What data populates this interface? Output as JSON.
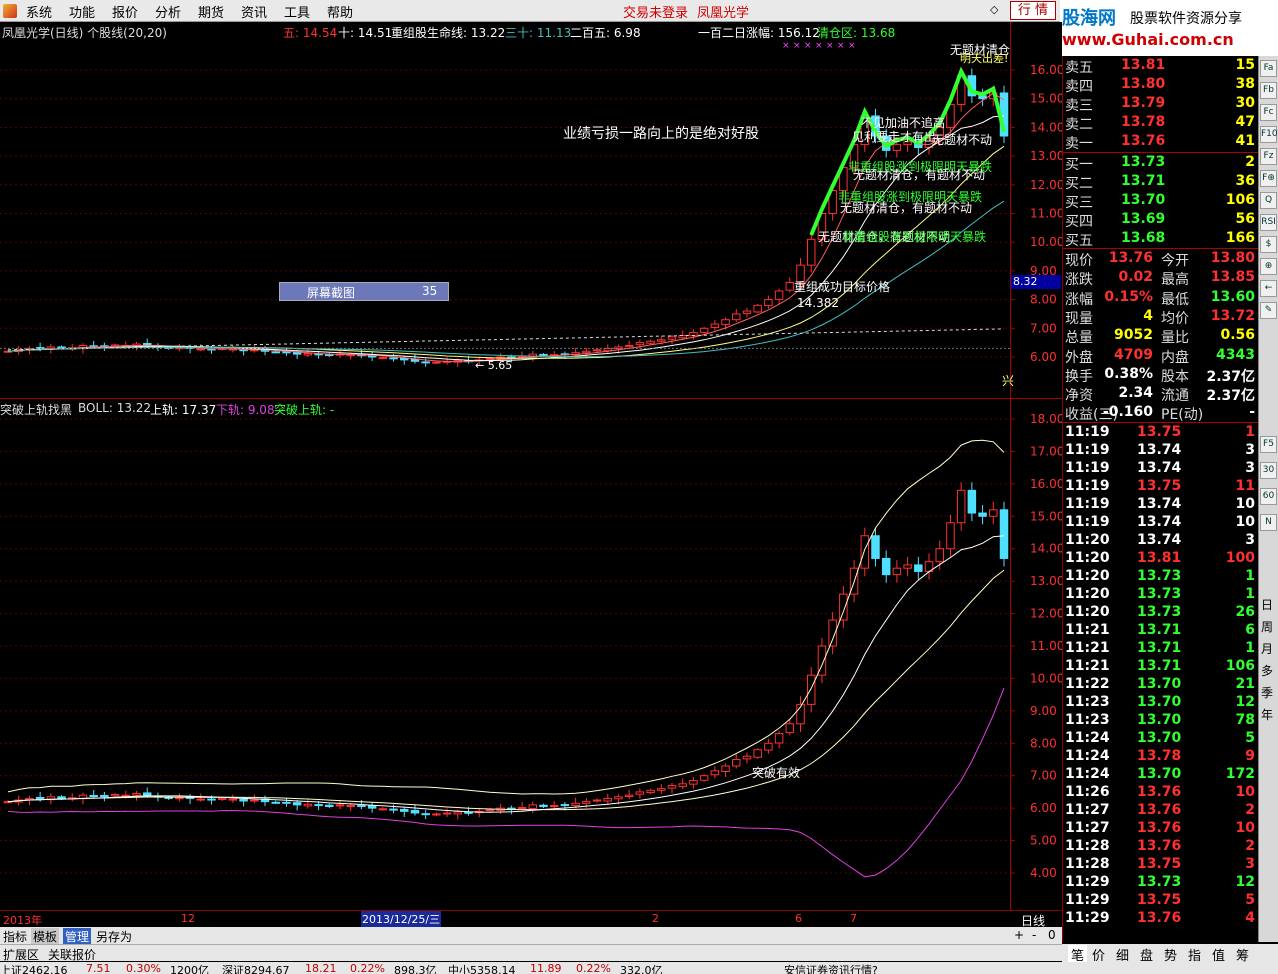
{
  "menu": {
    "items": [
      "系统",
      "功能",
      "报价",
      "分析",
      "期货",
      "资讯",
      "工具",
      "帮助"
    ],
    "login_status": "交易未登录",
    "stock_name": "凤凰光学",
    "quote_button": "行 情"
  },
  "banner": {
    "site_name": "股海网",
    "slogan": "股票软件资源分享",
    "url": "www.Guhai.com.cn"
  },
  "main_chart": {
    "title": "凤凰光学(日线) 个股线(20,20)",
    "ma5": "五: 14.54",
    "ma10": "十: 14.51",
    "restructure_line": "重组股生命线: 13.22",
    "ma30": "三十: 11.13",
    "ma250": "二百五: 6.98",
    "rise_120": "一百二日涨幅: 156.12",
    "clear_zone": "清仓区: 13.68",
    "overlay_text": "业绩亏损一路向上的是绝对好股",
    "target_label": "重组成功目标价格",
    "target_value": "14.382",
    "low_label": "← 5.65",
    "current_price_tag": "8.32",
    "screenshot_label": "屏幕截图",
    "screenshot_count": "35",
    "annotations": {
      "chase": "不见加油不追高",
      "sell": "见利要走才有出",
      "no_theme_1": "无题材不动",
      "warn_1": "非重组股涨到极限明天暴跌",
      "no_theme_2": "无题材清仓，有题材不动",
      "warn_2": "非重组股涨到极限明天暴跌",
      "no_theme_3": "无题材清仓，有题材不动",
      "no_theme_4": "无题材清仓，有题材不动",
      "warn_3": "非重组股涨到极限明天暴跌",
      "top_1": "无题材清仓",
      "top_2": "明天出差!"
    },
    "y_ticks": [
      "16.00",
      "15.00",
      "14.00",
      "13.00",
      "12.00",
      "11.00",
      "10.00",
      "9.00",
      "8.00",
      "7.00",
      "6.00"
    ],
    "x_edge_label": "兴"
  },
  "sub_chart": {
    "title": "突破上轨找黑",
    "boll_label": "BOLL: 13.22",
    "upper_label": "上轨: 17.37",
    "lower_label": "下轨: 9.08",
    "breakout_label": "突破上轨: -",
    "breakout_annotation": "突破有效",
    "y_ticks": [
      "18.00",
      "17.00",
      "16.00",
      "15.00",
      "14.00",
      "13.00",
      "12.00",
      "11.00",
      "10.00",
      "9.00",
      "8.00",
      "7.00",
      "6.00",
      "5.00",
      "4.00"
    ]
  },
  "time_axis": {
    "labels": [
      "2013年",
      "12",
      "2013/12/25/三",
      "2",
      "6",
      "7"
    ],
    "period": "日线"
  },
  "order_book": {
    "asks": [
      {
        "label": "卖五",
        "price": "13.81",
        "vol": "15"
      },
      {
        "label": "卖四",
        "price": "13.80",
        "vol": "38"
      },
      {
        "label": "卖三",
        "price": "13.79",
        "vol": "30"
      },
      {
        "label": "卖二",
        "price": "13.78",
        "vol": "47"
      },
      {
        "label": "卖一",
        "price": "13.76",
        "vol": "41"
      }
    ],
    "bids": [
      {
        "label": "买一",
        "price": "13.73",
        "vol": "2"
      },
      {
        "label": "买二",
        "price": "13.71",
        "vol": "36"
      },
      {
        "label": "买三",
        "price": "13.70",
        "vol": "106"
      },
      {
        "label": "买四",
        "price": "13.69",
        "vol": "56"
      },
      {
        "label": "买五",
        "price": "13.68",
        "vol": "166"
      }
    ]
  },
  "stats": [
    {
      "l1": "现价",
      "v1": "13.76",
      "c1": "#ff3030",
      "l2": "今开",
      "v2": "13.80",
      "c2": "#ff3030"
    },
    {
      "l1": "涨跌",
      "v1": "0.02",
      "c1": "#ff3030",
      "l2": "最高",
      "v2": "13.85",
      "c2": "#ff3030"
    },
    {
      "l1": "涨幅",
      "v1": "0.15%",
      "c1": "#ff3030",
      "l2": "最低",
      "v2": "13.60",
      "c2": "#30ff30"
    },
    {
      "l1": "现量",
      "v1": "4",
      "c1": "#ffff00",
      "l2": "均价",
      "v2": "13.72",
      "c2": "#ff3030"
    },
    {
      "l1": "总量",
      "v1": "9052",
      "c1": "#ffff00",
      "l2": "量比",
      "v2": "0.56",
      "c2": "#ffff00"
    },
    {
      "l1": "外盘",
      "v1": "4709",
      "c1": "#ff3030",
      "l2": "内盘",
      "v2": "4343",
      "c2": "#30ff30"
    },
    {
      "l1": "换手",
      "v1": "0.38%",
      "c1": "#fff",
      "l2": "股本",
      "v2": "2.37亿",
      "c2": "#fff"
    },
    {
      "l1": "净资",
      "v1": "2.34",
      "c1": "#fff",
      "l2": "流通",
      "v2": "2.37亿",
      "c2": "#fff"
    },
    {
      "l1": "收益(三)",
      "v1": "-0.160",
      "c1": "#fff",
      "l2": "PE(动)",
      "v2": "-",
      "c2": "#fff"
    }
  ],
  "ticks": [
    {
      "t": "11:19",
      "p": "13.75",
      "v": "1",
      "c": "#ff3030"
    },
    {
      "t": "11:19",
      "p": "13.74",
      "v": "3",
      "c": "#fff"
    },
    {
      "t": "11:19",
      "p": "13.74",
      "v": "3",
      "c": "#fff"
    },
    {
      "t": "11:19",
      "p": "13.75",
      "v": "11",
      "c": "#ff3030"
    },
    {
      "t": "11:19",
      "p": "13.74",
      "v": "10",
      "c": "#fff"
    },
    {
      "t": "11:19",
      "p": "13.74",
      "v": "10",
      "c": "#fff"
    },
    {
      "t": "11:20",
      "p": "13.74",
      "v": "3",
      "c": "#fff"
    },
    {
      "t": "11:20",
      "p": "13.81",
      "v": "100",
      "c": "#ff3030"
    },
    {
      "t": "11:20",
      "p": "13.73",
      "v": "1",
      "c": "#30ff30"
    },
    {
      "t": "11:20",
      "p": "13.73",
      "v": "1",
      "c": "#30ff30"
    },
    {
      "t": "11:20",
      "p": "13.73",
      "v": "26",
      "c": "#30ff30"
    },
    {
      "t": "11:21",
      "p": "13.71",
      "v": "6",
      "c": "#30ff30"
    },
    {
      "t": "11:21",
      "p": "13.71",
      "v": "1",
      "c": "#30ff30"
    },
    {
      "t": "11:21",
      "p": "13.71",
      "v": "106",
      "c": "#30ff30"
    },
    {
      "t": "11:22",
      "p": "13.70",
      "v": "21",
      "c": "#30ff30"
    },
    {
      "t": "11:23",
      "p": "13.70",
      "v": "12",
      "c": "#30ff30"
    },
    {
      "t": "11:23",
      "p": "13.70",
      "v": "78",
      "c": "#30ff30"
    },
    {
      "t": "11:24",
      "p": "13.70",
      "v": "5",
      "c": "#30ff30"
    },
    {
      "t": "11:24",
      "p": "13.78",
      "v": "9",
      "c": "#ff3030"
    },
    {
      "t": "11:24",
      "p": "13.70",
      "v": "172",
      "c": "#30ff30"
    },
    {
      "t": "11:26",
      "p": "13.76",
      "v": "10",
      "c": "#ff3030"
    },
    {
      "t": "11:27",
      "p": "13.76",
      "v": "2",
      "c": "#ff3030"
    },
    {
      "t": "11:27",
      "p": "13.76",
      "v": "10",
      "c": "#ff3030"
    },
    {
      "t": "11:28",
      "p": "13.76",
      "v": "2",
      "c": "#ff3030"
    },
    {
      "t": "11:28",
      "p": "13.75",
      "v": "3",
      "c": "#ff3030"
    },
    {
      "t": "11:29",
      "p": "13.73",
      "v": "12",
      "c": "#30ff30"
    },
    {
      "t": "11:29",
      "p": "13.75",
      "v": "5",
      "c": "#ff3030"
    },
    {
      "t": "11:29",
      "p": "13.76",
      "v": "4",
      "c": "#ff3030"
    }
  ],
  "tools": [
    "Fa",
    "Fb",
    "Fc",
    "F10",
    "Fz",
    "F⊕",
    "Q",
    "RSI",
    "$",
    "⊕",
    "←",
    "✎",
    "F5",
    "30",
    "60",
    "N"
  ],
  "periods": [
    "日",
    "周",
    "月",
    "多",
    "季",
    "年"
  ],
  "bottom_tabs": {
    "row1": [
      "指标",
      "模板",
      "管理",
      "另存为"
    ],
    "row2": [
      "扩展区",
      "关联报价"
    ],
    "right": [
      "笔",
      "价",
      "细",
      "盘",
      "势",
      "指",
      "值",
      "筹"
    ],
    "zoom": [
      "+",
      "-",
      "0"
    ]
  },
  "ticker": [
    "上证2462.16",
    "7.51",
    "0.30%",
    "1200亿",
    "深证8294.67",
    "18.21",
    "0.22%",
    "898.3亿",
    "中小5358.14",
    "11.89",
    "0.22%",
    "332.0亿",
    "安信证券资讯行情?"
  ],
  "chart_data": [
    {
      "type": "candlestick",
      "title": "凤凰光学(日线) 个股线(20,20)",
      "ylim": [
        5.5,
        16.6
      ],
      "series": [
        {
          "name": "五",
          "last": 14.54
        },
        {
          "name": "十",
          "last": 14.51
        },
        {
          "name": "重组股生命线",
          "last": 13.22
        },
        {
          "name": "三十",
          "last": 11.13
        },
        {
          "name": "二百五",
          "last": 6.98
        }
      ],
      "closes": [
        6.2,
        6.25,
        6.3,
        6.28,
        6.35,
        6.3,
        6.32,
        6.4,
        6.38,
        6.35,
        6.42,
        6.4,
        6.45,
        6.4,
        6.35,
        6.3,
        6.32,
        6.3,
        6.28,
        6.25,
        6.3,
        6.28,
        6.22,
        6.25,
        6.2,
        6.18,
        6.15,
        6.1,
        6.12,
        6.08,
        6.05,
        6.1,
        6.08,
        6.05,
        6.0,
        5.98,
        5.95,
        5.9,
        5.85,
        5.8,
        5.82,
        5.85,
        5.88,
        5.85,
        5.9,
        5.95,
        6.0,
        5.98,
        6.02,
        6.1,
        6.05,
        6.08,
        6.1,
        6.15,
        6.2,
        6.25,
        6.3,
        6.35,
        6.4,
        6.5,
        6.55,
        6.6,
        6.7,
        6.75,
        6.85,
        7.0,
        7.15,
        7.3,
        7.5,
        7.6,
        7.8,
        8.0,
        8.3,
        8.6,
        9.2,
        10.1,
        11.0,
        11.8,
        12.6,
        13.4,
        14.4,
        13.7,
        13.2,
        13.4,
        13.5,
        13.3,
        13.6,
        14.0,
        14.8,
        15.8,
        15.1,
        15.0,
        15.2,
        13.7
      ],
      "clear_zone": 13.68,
      "rise_120": 156.12,
      "target_price": 14.382,
      "low_marker": 5.65
    },
    {
      "type": "line",
      "title": "突破上轨找黑",
      "ylim": [
        3.5,
        18.5
      ],
      "series": [
        {
          "name": "BOLL",
          "last": 13.22
        },
        {
          "name": "上轨",
          "last": 17.37
        },
        {
          "name": "下轨",
          "last": 9.08
        }
      ]
    }
  ]
}
